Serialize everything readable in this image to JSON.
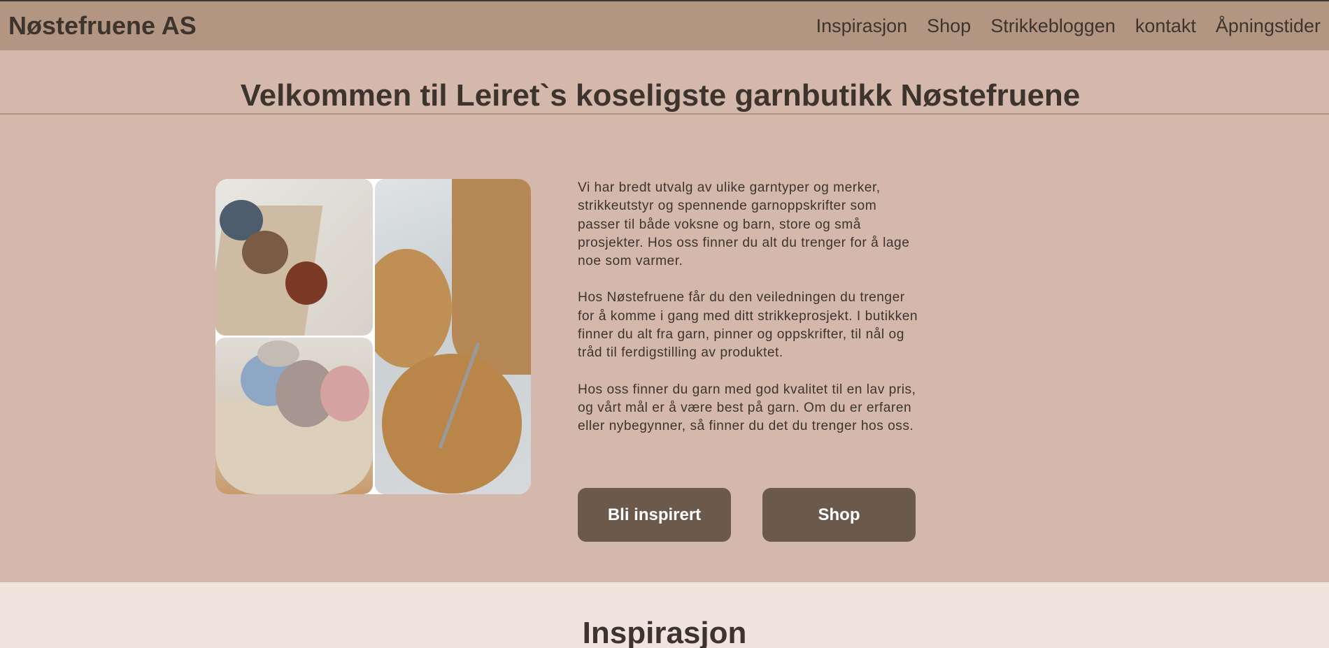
{
  "header": {
    "logo": "Nøstefruene AS",
    "nav": [
      "Inspirasjon",
      "Shop",
      "Strikkebloggen",
      "kontakt",
      "Åpningstider"
    ]
  },
  "hero": {
    "title": "Velkommen til Leiret`s koseligste garnbutikk Nøstefruene",
    "paragraphs": [
      "Vi har bredt utvalg av ulike garntyper og merker, strikkeutstyr og spennende garnoppskrifter som passer til både voksne og barn, store og små prosjekter. Hos oss finner du alt du trenger for å lage noe som varmer.",
      "Hos Nøstefruene får du den veiledningen du trenger for å komme i gang med ditt strikkeprosjekt. I butikken finner du alt fra garn, pinner og oppskrifter, til nål og tråd til ferdigstilling av produktet.",
      "Hos oss finner du garn med god kvalitet til en lav pris, og vårt mål er å være best på garn. Om du er erfaren eller nybegynner, så finner du det du trenger hos oss."
    ],
    "buttons": {
      "inspire": "Bli inspirert",
      "shop": "Shop"
    }
  },
  "inspiration": {
    "title": "Inspirasjon"
  },
  "colors": {
    "header_bg": "#b39682",
    "page_bg": "#d4b8ac",
    "button_bg": "#6b5a4c",
    "text": "#3e342e",
    "section_bg": "#f0e4dc"
  }
}
